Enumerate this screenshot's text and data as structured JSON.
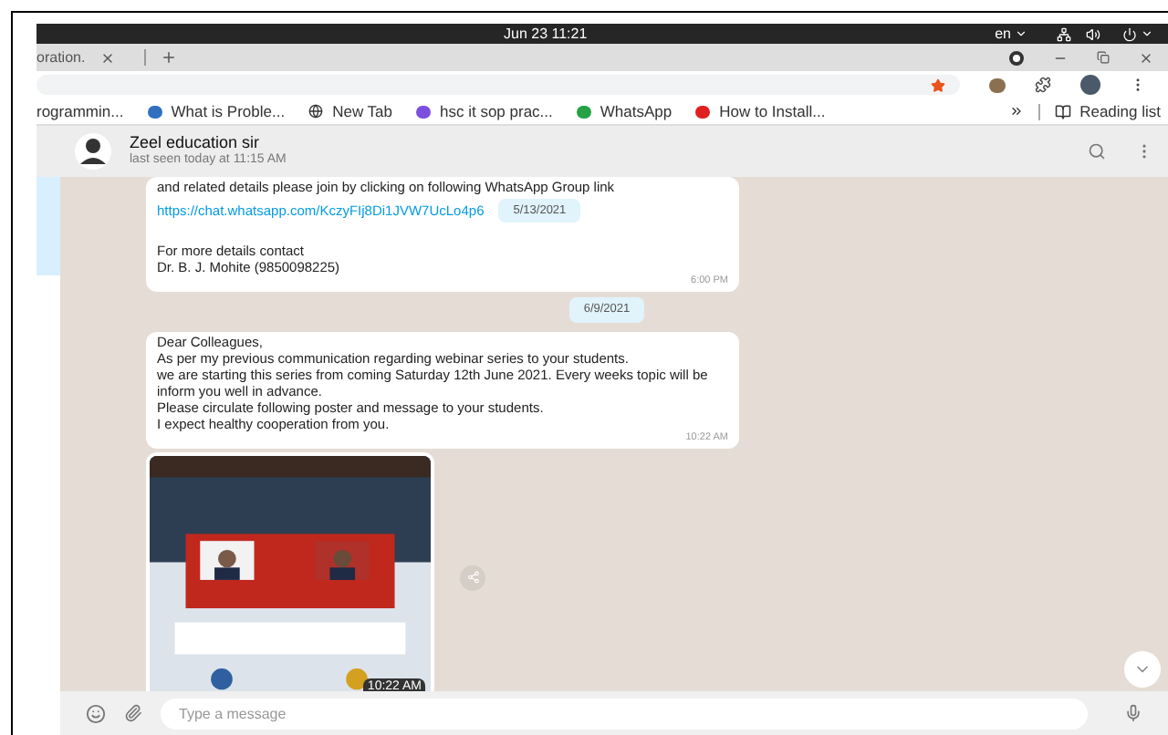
{
  "top_bar": {
    "clock": "Jun 23  11:21",
    "language": "en"
  },
  "browser": {
    "tabs": [
      {
        "label": "oration.",
        "selected": true
      }
    ],
    "bookmarks": [
      {
        "label": "rogrammin...",
        "kind": "plain"
      },
      {
        "label": "What is Proble...",
        "kind": "blue"
      },
      {
        "label": "New Tab",
        "kind": "globe"
      },
      {
        "label": "hsc it sop prac...",
        "kind": "purple"
      },
      {
        "label": "WhatsApp",
        "kind": "green"
      },
      {
        "label": "How to Install...",
        "kind": "red"
      }
    ],
    "reading_list": "Reading list"
  },
  "chat": {
    "contact": "Zeel education sir",
    "status": "last seen today at 11:15 AM",
    "messages": [
      {
        "kind": "text",
        "lines": [
          "and related details please join by clicking on following WhatsApp Group link"
        ],
        "link": "https://chat.whatsapp.com/KczyFIj8Di1JVW7UcLo4p6",
        "date_chip": "5/13/2021",
        "tail": [
          "For more details contact",
          "Dr. B. J. Mohite (9850098225)"
        ],
        "time": "6:00 PM"
      },
      {
        "kind": "date",
        "date_chip": "6/9/2021"
      },
      {
        "kind": "text",
        "lines": [
          "Dear Colleagues,",
          "As per my previous communication regarding webinar series to your students.",
          "we are starting this series from coming Saturday 12th June 2021. Every weeks topic will be inform you well in advance.",
          "Please circulate following poster and message to your students.",
          "I expect healthy cooperation from you."
        ],
        "time": "10:22 AM"
      },
      {
        "time": "10:22 AM"
      }
    ],
    "composer": {
      "placeholder": "Type a message"
    }
  }
}
